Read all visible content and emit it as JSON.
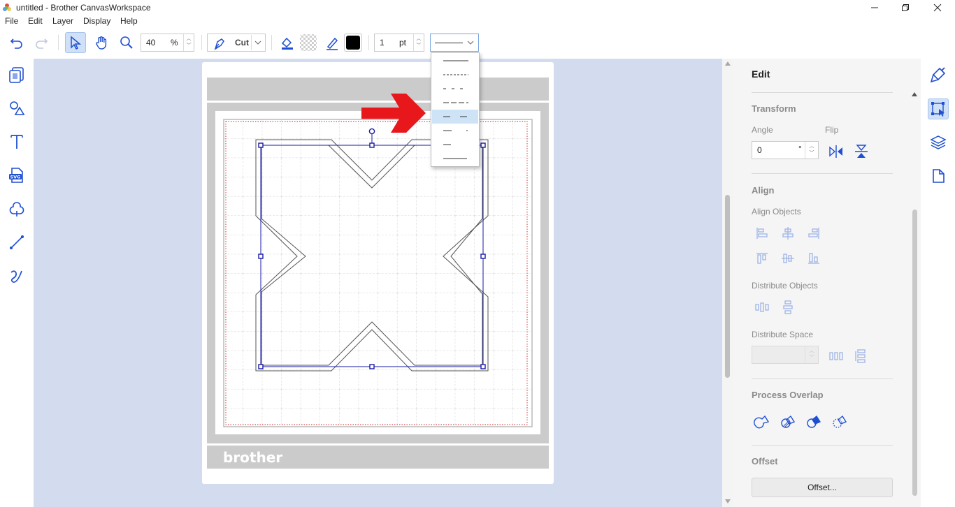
{
  "window": {
    "title": "untitled - Brother CanvasWorkspace",
    "controls": [
      "minimize",
      "maximize",
      "close"
    ]
  },
  "menu": [
    "File",
    "Edit",
    "Layer",
    "Display",
    "Help"
  ],
  "toolbar": {
    "zoom_value": "40",
    "zoom_unit": "%",
    "mode_label": "Cut",
    "line_width_value": "1",
    "line_width_unit": "pt",
    "fill_color": "#000000"
  },
  "line_type_dropdown": {
    "options": [
      "solid",
      "fine-dash",
      "dash",
      "long-dash",
      "wide-dash",
      "dash-dot",
      "sparse-dash",
      "solid-long"
    ],
    "highlighted_index": 4
  },
  "mat": {
    "brand": "brother"
  },
  "right_panel": {
    "title": "Edit",
    "transform": {
      "heading": "Transform",
      "angle_label": "Angle",
      "angle_value": "0",
      "angle_unit": "°",
      "flip_label": "Flip"
    },
    "align": {
      "heading": "Align",
      "align_objects_label": "Align Objects",
      "distribute_objects_label": "Distribute Objects",
      "distribute_space_label": "Distribute Space",
      "distribute_space_value": ""
    },
    "process_overlap": {
      "heading": "Process Overlap"
    },
    "offset": {
      "heading": "Offset",
      "button_label": "Offset..."
    }
  },
  "colors": {
    "accent": "#1f4fd1",
    "canvas_bg": "#d3dcee",
    "selection": "#0000aa",
    "arrow": "#e8171b",
    "cut_area": "#cc2222"
  }
}
